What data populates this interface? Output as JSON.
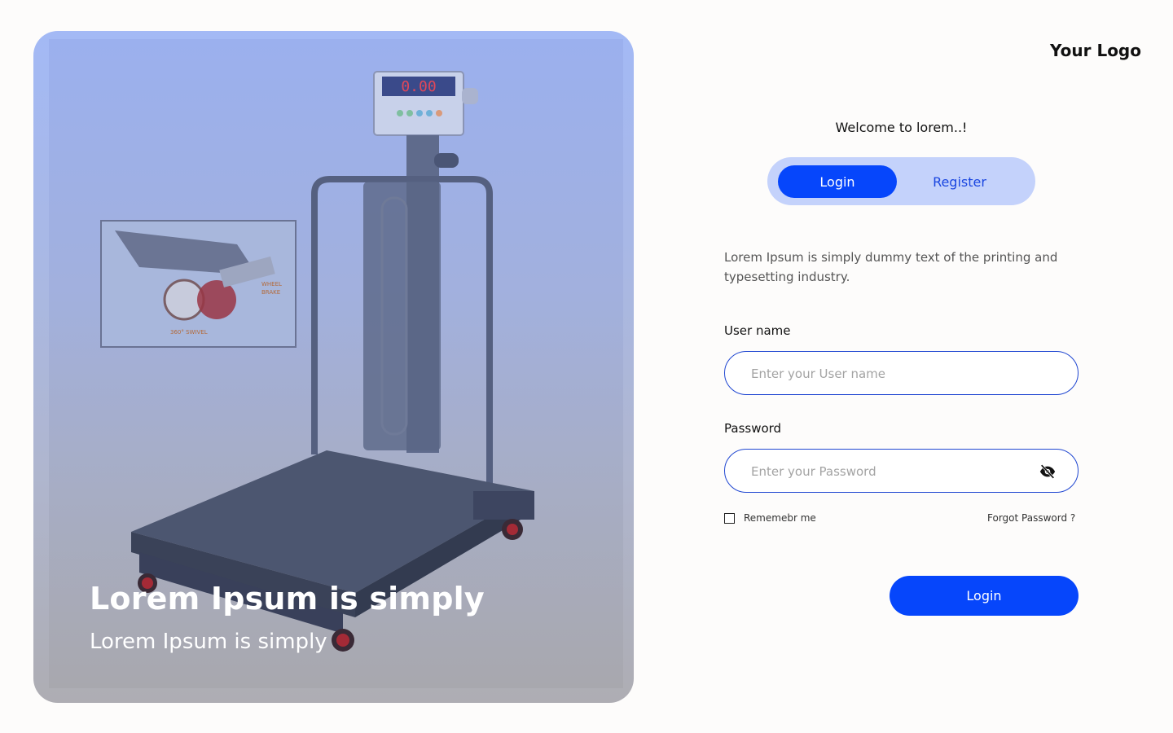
{
  "hero": {
    "title": "Lorem Ipsum is simply",
    "subtitle": "Lorem Ipsum is simply",
    "display_reading": "0.00",
    "inset_labels": [
      "WHEEL",
      "BRAKE",
      "360° SWIVEL"
    ]
  },
  "logo": "Your Logo",
  "welcome": "Welcome to lorem..!",
  "tabs": {
    "login": "Login",
    "register": "Register"
  },
  "description": "Lorem Ipsum is simply dummy text of the printing and typesetting industry.",
  "username": {
    "label": "User name",
    "placeholder": "Enter your User name"
  },
  "password": {
    "label": "Password",
    "placeholder": "Enter your Password"
  },
  "remember_label": "Rememebr me",
  "forgot_label": "Forgot Password ?",
  "submit_label": "Login",
  "colors": {
    "primary": "#0646fb",
    "toggle_bg": "#c4d2fb",
    "input_border": "#1f46d1"
  },
  "icons": {
    "password_toggle": "eye-off-icon"
  }
}
